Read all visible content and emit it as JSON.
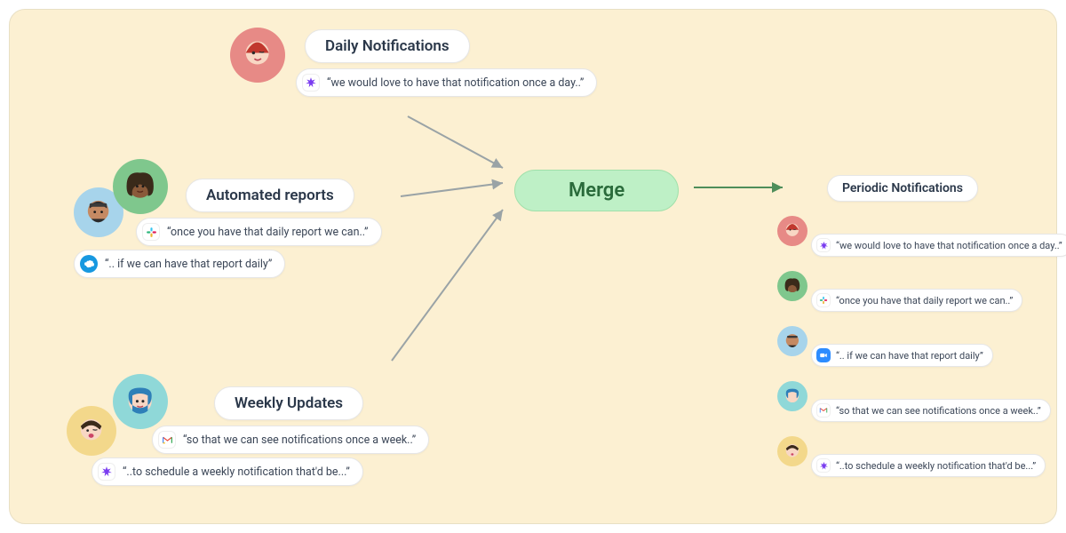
{
  "groups": [
    {
      "title": "Daily Notifications",
      "quotes": [
        {
          "icon": "spark",
          "text": "“we would love to have that notification once a day..”"
        }
      ]
    },
    {
      "title": "Automated reports",
      "quotes": [
        {
          "icon": "slack",
          "text": "“once you have that daily report we can..”"
        },
        {
          "icon": "cloud",
          "text": "“.. if we can have that report daily”"
        }
      ]
    },
    {
      "title": "Weekly Updates",
      "quotes": [
        {
          "icon": "gmail",
          "text": "“so that we can see notifications once a week..”"
        },
        {
          "icon": "spark",
          "text": "“..to schedule a weekly notification that'd be...”"
        }
      ]
    }
  ],
  "merge_label": "Merge",
  "result": {
    "title": "Periodic Notifications",
    "items": [
      {
        "icon": "spark",
        "text": "“we would love to have that notification once a day..”"
      },
      {
        "icon": "slack",
        "text": "“once you have that daily report we can..”"
      },
      {
        "icon": "zoom",
        "text": "“.. if we can have that report daily”"
      },
      {
        "icon": "gmail",
        "text": "“so that we can see notifications once a week..”"
      },
      {
        "icon": "spark",
        "text": "“..to schedule a weekly notification that'd be...”"
      }
    ]
  },
  "avatars": {
    "red": "#E78A86",
    "green": "#7FC78D",
    "blue": "#A7D4EB",
    "teal": "#8FD8D8",
    "yellow": "#F3D88B"
  }
}
